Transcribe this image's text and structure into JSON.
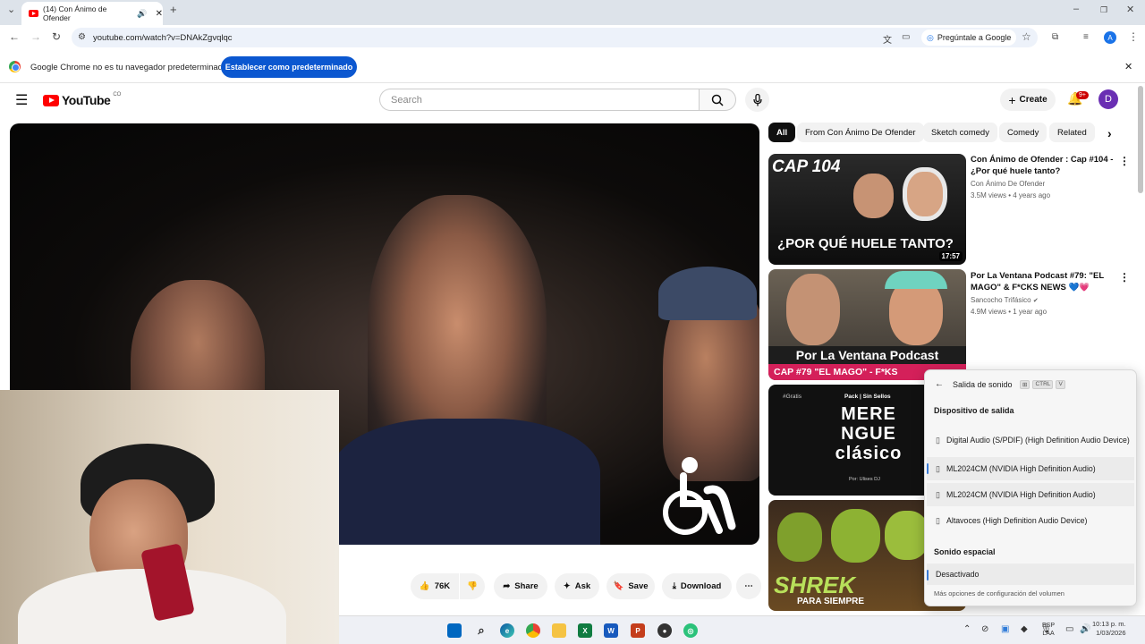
{
  "browser": {
    "tab_title": "(14) Con Ánimo de Ofender",
    "url": "youtube.com/watch?v=DNAkZgvqlqc",
    "ask_google": "Pregúntale a Google",
    "profile_initial": "A"
  },
  "infobar": {
    "message": "Google Chrome no es tu navegador predeterminado",
    "button": "Establecer como predeterminado"
  },
  "youtube": {
    "logo": "YouTube",
    "region": "CO",
    "search_placeholder": "Search",
    "create": "Create",
    "notifications": "9+",
    "avatar": "D"
  },
  "chips": [
    "All",
    "From Con Ánimo De Ofender",
    "Sketch comedy",
    "Comedy",
    "Related"
  ],
  "recommended": [
    {
      "title": "Con Ánimo de Ofender : Cap #104 - ¿Por qué huele tanto?",
      "channel": "Con Ánimo De Ofender",
      "meta": "3.5M views • 4 years ago",
      "duration": "17:57",
      "thumb_top": "CAP 104",
      "thumb_bottom": "¿POR QUÉ HUELE TANTO?"
    },
    {
      "title": "Por La Ventana Podcast #79: \"EL MAGO\" & F*CKS NEWS 💙💗",
      "channel": "Sancocho Trifásico",
      "meta": "4.9M views • 1 year ago",
      "thumb_top": "Por La Ventana Podcast",
      "thumb_bottom": "CAP #79 \"EL MAGO\" - F*KS"
    },
    {
      "thumb_tag": "#Gratis",
      "thumb_top": "Pack | Sin Sellos",
      "thumb_title": "MERE NGUE clásico",
      "thumb_by": "Por: Ulises DJ"
    },
    {
      "thumb_title": "SHREK",
      "thumb_bottom": "PARA SIEMPRE"
    }
  ],
  "actions": {
    "likes": "76K",
    "share": "Share",
    "ask": "Ask",
    "save": "Save",
    "download": "Download"
  },
  "sound_panel": {
    "title": "Salida de sonido",
    "shortcut_ctrl": "CTRL",
    "shortcut_v": "V",
    "output_header": "Dispositivo de salida",
    "devices": [
      "Digital Audio (S/PDIF) (High Definition Audio Device)",
      "ML2024CM (NVIDIA High Definition Audio)",
      "ML2024CM (NVIDIA High Definition Audio)",
      "Altavoces (High Definition Audio Device)"
    ],
    "spatial_header": "Sonido espacial",
    "spatial_value": "Desactivado",
    "more": "Más opciones de configuración del volumen"
  },
  "taskbar": {
    "lang_1": "ESP",
    "lang_2": "LAA",
    "time": "10:13 p. m.",
    "date": "1/03/2026"
  }
}
